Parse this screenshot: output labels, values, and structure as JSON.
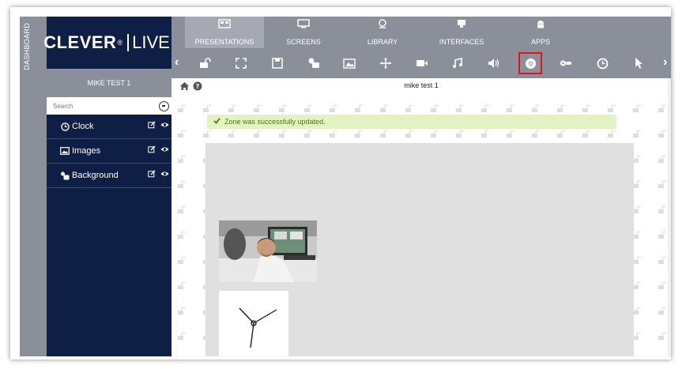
{
  "app": {
    "brand_main": "CLEVER",
    "brand_reg": "®",
    "brand_live": "LIVE",
    "dashboard_label": "DASHBOARD"
  },
  "colors": {
    "sidebar": "#0f1e45",
    "nav": "#8a8f9a",
    "nav_active": "#a5a9b3",
    "notice_bg": "#e3f3c4",
    "notice_text": "#4a7a12",
    "highlight": "#e0141e"
  },
  "sidebar": {
    "user_name": "MIKE TEST 1",
    "search_placeholder": "Search",
    "zones": [
      {
        "label": "Clock",
        "icon": "clock-icon"
      },
      {
        "label": "Images",
        "icon": "image-icon"
      },
      {
        "label": "Background",
        "icon": "shapes-icon"
      }
    ]
  },
  "nav": {
    "tabs": [
      {
        "label": "PRESENTATIONS",
        "icon": "presentations-icon",
        "active": true
      },
      {
        "label": "SCREENS",
        "icon": "monitor-icon"
      },
      {
        "label": "LIBRARY",
        "icon": "library-icon"
      },
      {
        "label": "INTERFACES",
        "icon": "interfaces-icon"
      },
      {
        "label": "APPS",
        "icon": "android-icon"
      }
    ]
  },
  "toolbar": {
    "tools": [
      "unlock-icon",
      "fullscreen-icon",
      "save-icon",
      "shapes-icon",
      "image-icon",
      "move-icon",
      "video-icon",
      "music-icon",
      "volume-icon",
      "chrome-icon",
      "ticket-icon",
      "clock-icon",
      "pointer-icon"
    ],
    "selected": "chrome-icon"
  },
  "content": {
    "title": "mike test 1",
    "notice": "Zone was successfully updated."
  }
}
